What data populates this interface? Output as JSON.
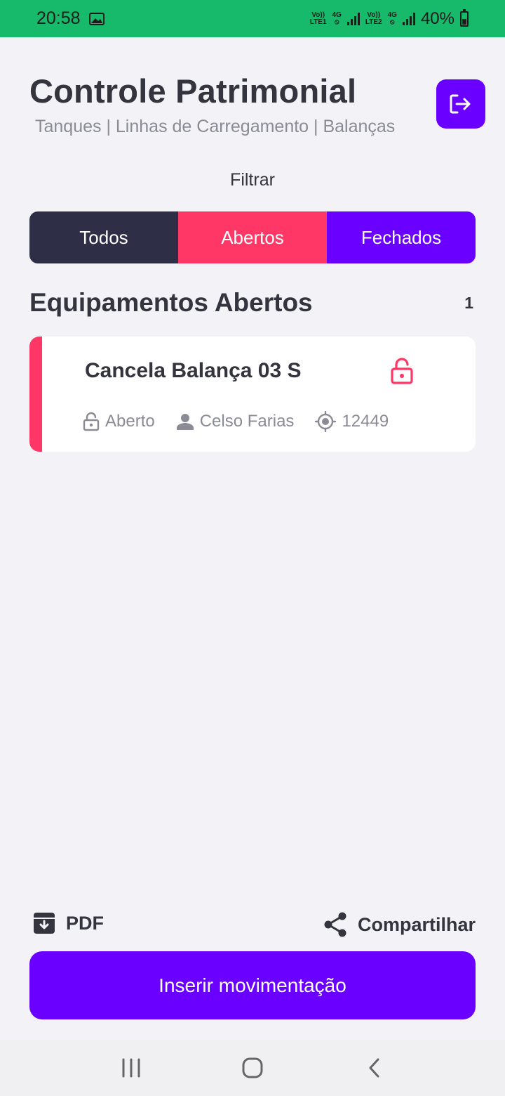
{
  "status_bar": {
    "time": "20:58",
    "sim1": {
      "top": "Vo))",
      "bottom": "LTE1",
      "tech": "4G"
    },
    "sim2": {
      "top": "Vo))",
      "bottom": "LTE2",
      "tech": "4G"
    },
    "battery": "40%"
  },
  "header": {
    "title": "Controle Patrimonial",
    "subtitle": "Tanques | Linhas de Carregamento | Balanças",
    "logout_icon": "logout-icon"
  },
  "filter": {
    "label": "Filtrar",
    "options": [
      {
        "label": "Todos",
        "color": "#2e2f47"
      },
      {
        "label": "Abertos",
        "color": "#ff3767"
      },
      {
        "label": "Fechados",
        "color": "#6a00ff"
      }
    ],
    "selected": "Abertos"
  },
  "section": {
    "title": "Equipamentos Abertos",
    "count": "1"
  },
  "items": [
    {
      "name": "Cancela Balança 03 S",
      "status": "Aberto",
      "user": "Celso Farias",
      "code": "12449",
      "status_color": "#ff3767",
      "icons": {
        "status": "lock-open-icon",
        "user": "person-icon",
        "code": "crosshair-icon"
      }
    }
  ],
  "actions": {
    "pdf_label": "PDF",
    "share_label": "Compartilhar",
    "primary_label": "Inserir movimentação"
  },
  "colors": {
    "accent": "#6a00ff",
    "open": "#ff3767",
    "dark": "#2e2f47",
    "status_bar": "#17b96a"
  }
}
